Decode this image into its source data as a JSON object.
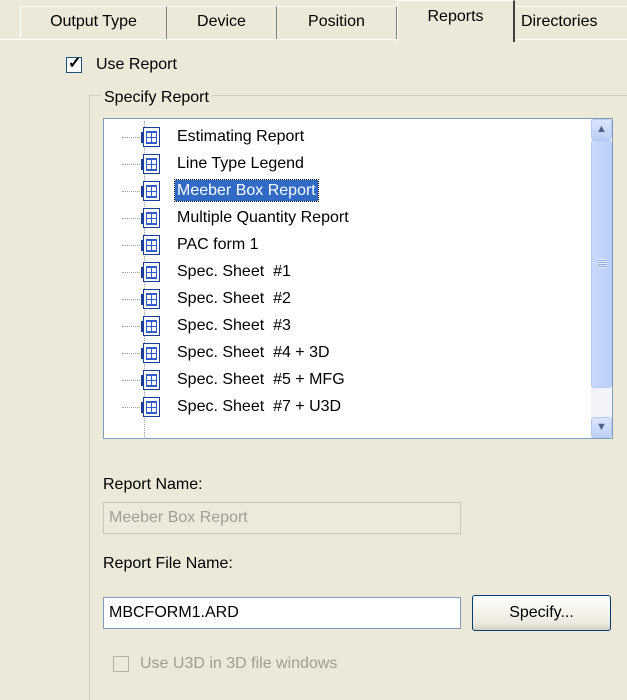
{
  "tabs": [
    {
      "label": "Output Type"
    },
    {
      "label": "Device"
    },
    {
      "label": "Position"
    },
    {
      "label": "Reports"
    },
    {
      "label": "Directories"
    }
  ],
  "use_report": {
    "label": "Use Report",
    "checked": true
  },
  "specify_report": {
    "legend": "Specify Report",
    "items": [
      {
        "label": "Estimating Report"
      },
      {
        "label": "Line Type Legend"
      },
      {
        "label": "Meeber Box Report",
        "selected": true
      },
      {
        "label": "Multiple Quantity Report"
      },
      {
        "label": "PAC form 1"
      },
      {
        "label": "Spec. Sheet  #1"
      },
      {
        "label": "Spec. Sheet  #2"
      },
      {
        "label": "Spec. Sheet  #3"
      },
      {
        "label": "Spec. Sheet  #4 + 3D"
      },
      {
        "label": "Spec. Sheet  #5 + MFG"
      },
      {
        "label": "Spec. Sheet  #7 + U3D"
      }
    ]
  },
  "report_name": {
    "label": "Report Name:",
    "value": "Meeber Box Report"
  },
  "report_file_name": {
    "label": "Report File Name:",
    "value": "MBCFORM1.ARD",
    "button": "Specify..."
  },
  "use_u3d": {
    "label": "Use U3D in 3D file windows",
    "checked": false
  }
}
